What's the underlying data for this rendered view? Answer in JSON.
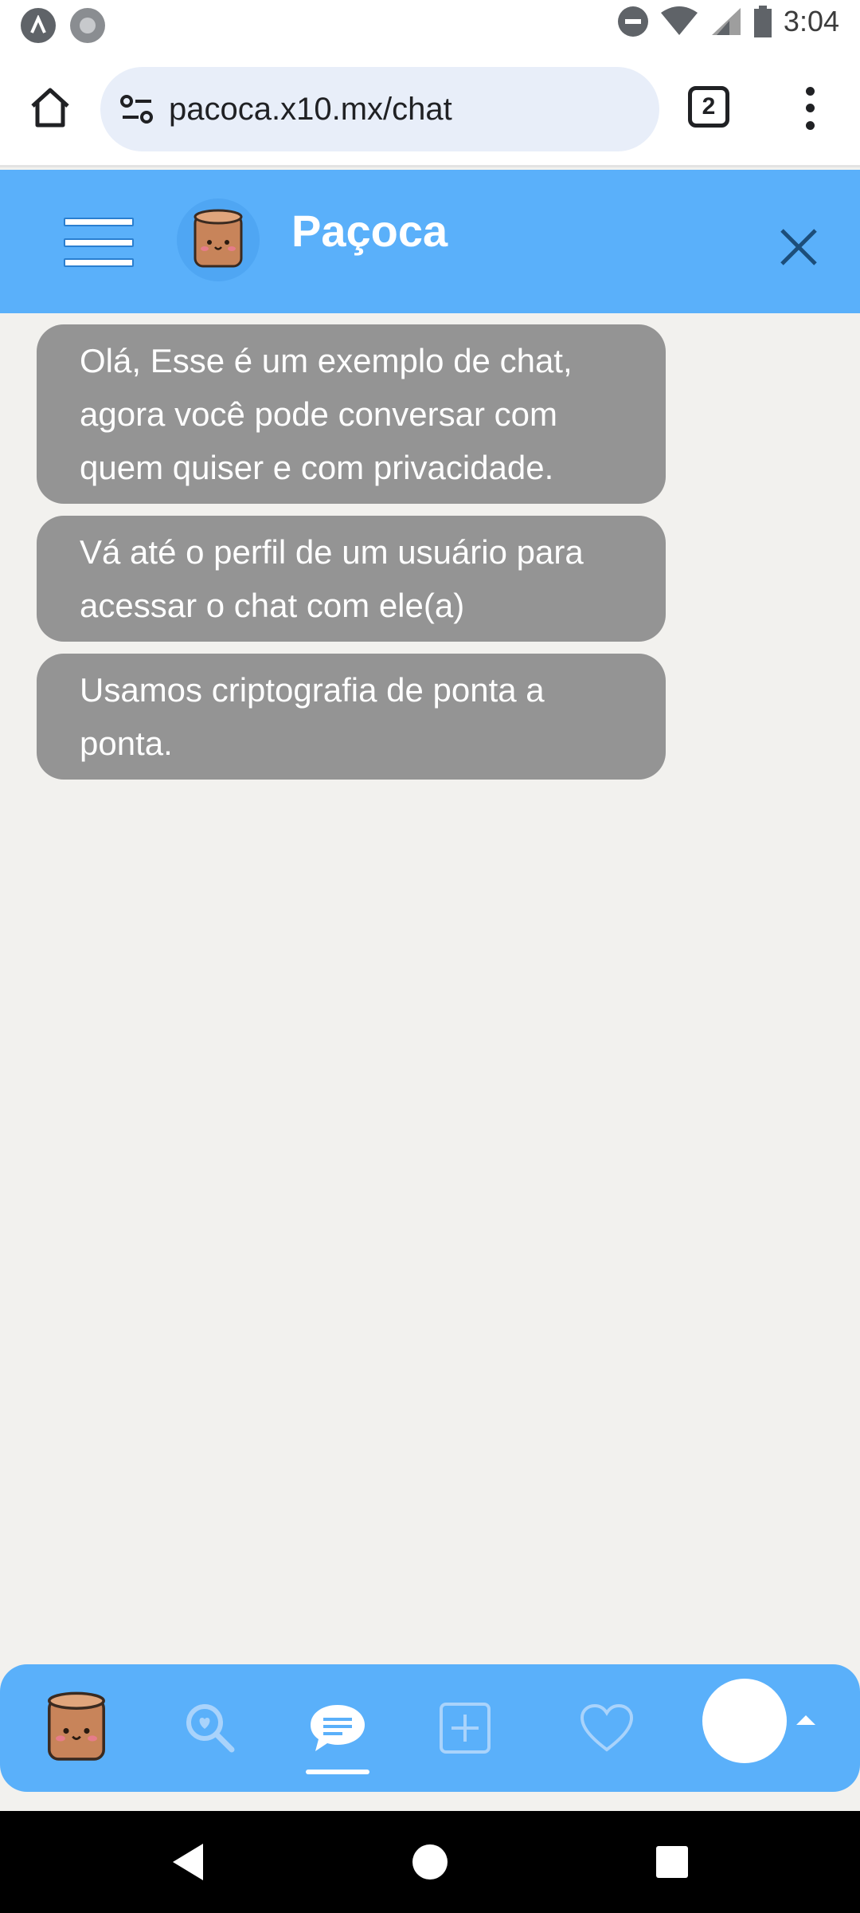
{
  "status_bar": {
    "time": "3:04",
    "icons": [
      "app-notification-icon",
      "record-icon",
      "do-not-disturb-icon",
      "wifi-icon",
      "signal-icon",
      "battery-icon"
    ]
  },
  "browser": {
    "url": "pacoca.x10.mx/chat",
    "tab_count": "2",
    "icons": [
      "home-icon",
      "site-settings-icon",
      "tabs-icon",
      "more-menu-icon"
    ]
  },
  "header": {
    "title": "Paçoca",
    "icons": [
      "menu-icon",
      "pacoca-logo",
      "close-icon"
    ],
    "accent_color": "#5ab0fa"
  },
  "chat": {
    "messages": [
      {
        "lines": [
          "Olá, Esse é um exemplo de chat,",
          "agora você pode conversar com",
          "quem quiser e com privacidade."
        ]
      },
      {
        "lines": [
          "Vá até o perfil de um usuário para",
          "acessar o chat com ele(a)"
        ]
      },
      {
        "lines": [
          "Usamos criptografia de ponta a",
          "ponta."
        ]
      }
    ],
    "bubble_color": "#949494"
  },
  "bottom_nav": {
    "items": [
      "home-logo",
      "search-icon",
      "chat-icon",
      "add-post-icon",
      "favorites-icon",
      "profile-avatar"
    ],
    "active": "chat-icon"
  },
  "system_nav": {
    "buttons": [
      "back-icon",
      "home-circle-icon",
      "recents-icon"
    ]
  }
}
